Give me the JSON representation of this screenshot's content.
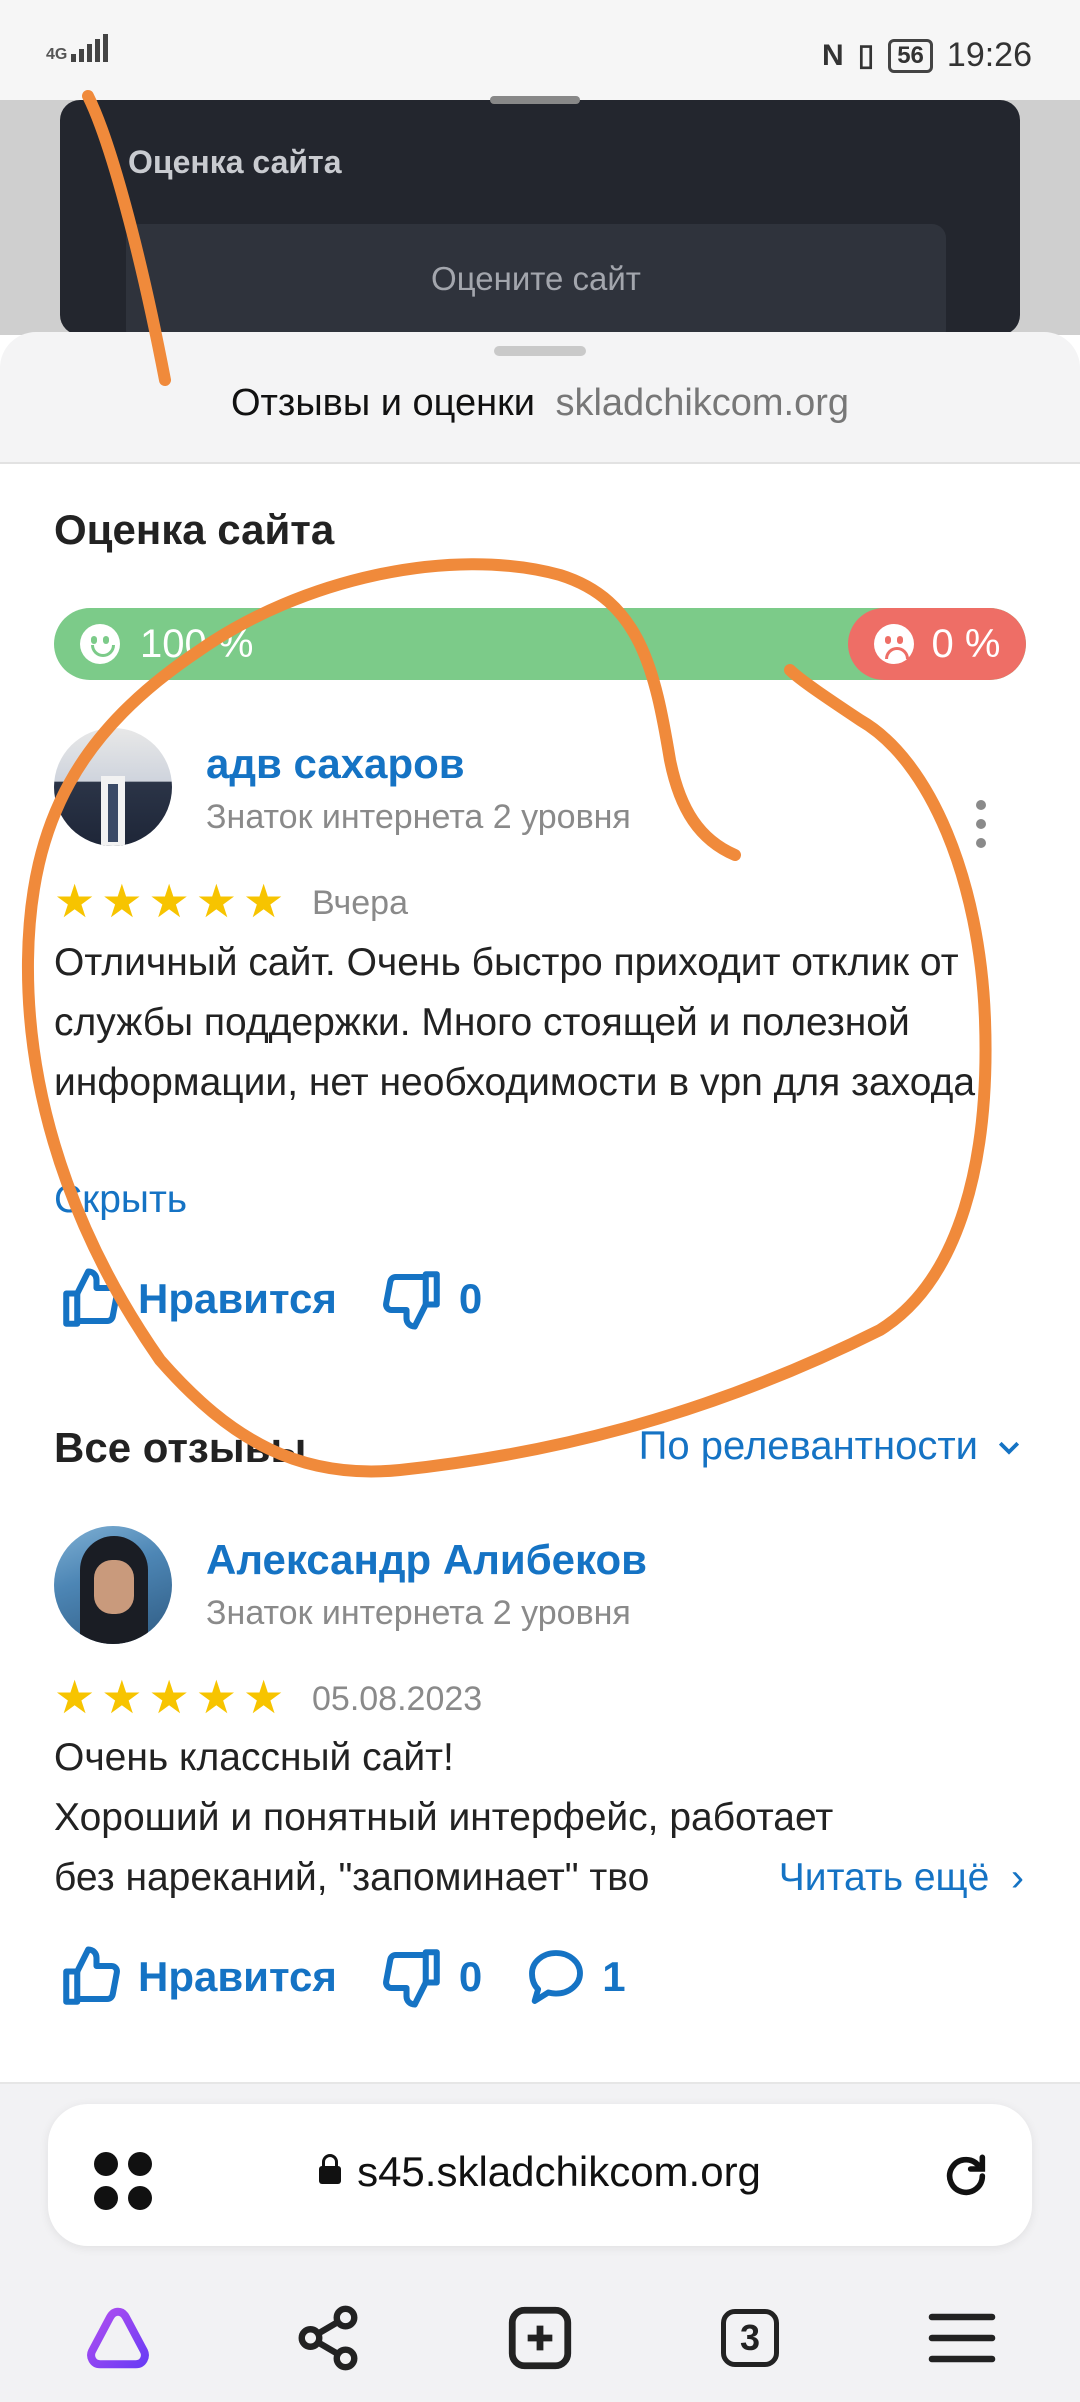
{
  "status_bar": {
    "network": "4G",
    "battery": "56",
    "time": "19:26"
  },
  "background_page": {
    "card_title": "Оценка сайта",
    "rate_prompt": "Оцените сайт"
  },
  "sheet": {
    "title": "Отзывы и оценки",
    "domain": "skladchikcom.org"
  },
  "rating": {
    "section_title": "Оценка сайта",
    "positive_percent": "100 %",
    "negative_percent": "0 %",
    "positive_share": 1.0,
    "positive_color": "#7ccb89",
    "negative_color": "#ee6e66"
  },
  "featured_review": {
    "author": "адв сахаров",
    "level": "Знаток интернета 2 уровня",
    "stars": 5,
    "date": "Вчера",
    "text": "Отличный сайт.  Очень быстро приходит отклик от службы поддержки.  Много стоящей и полезной информации,  нет необходимости в vpn для захода.",
    "collapse_label": "Скрыть",
    "like_label": "Нравится",
    "dislike_count": "0"
  },
  "all_reviews": {
    "title": "Все отзывы",
    "sort_label": "По релевантности"
  },
  "review_2": {
    "author": "Александр Алибеков",
    "level": "Знаток интернета 2 уровня",
    "stars": 5,
    "date": "05.08.2023",
    "text_line1": "Очень классный сайт!",
    "text_line2": "Хороший и понятный интерфейс, работает",
    "text_line3": "без нареканий, \"запоминает\" тво",
    "read_more": "Читать ещё",
    "like_label": "Нравится",
    "dislike_count": "0",
    "comment_count": "1"
  },
  "browser": {
    "url": "s45.skladchikcom.org",
    "tabs_count": "3"
  },
  "icons": {
    "star_color": "#f7c400",
    "link_color": "#1573c4",
    "alice": "alice-icon",
    "share": "share-icon",
    "new_tab": "new-tab-icon",
    "menu": "menu-icon"
  }
}
